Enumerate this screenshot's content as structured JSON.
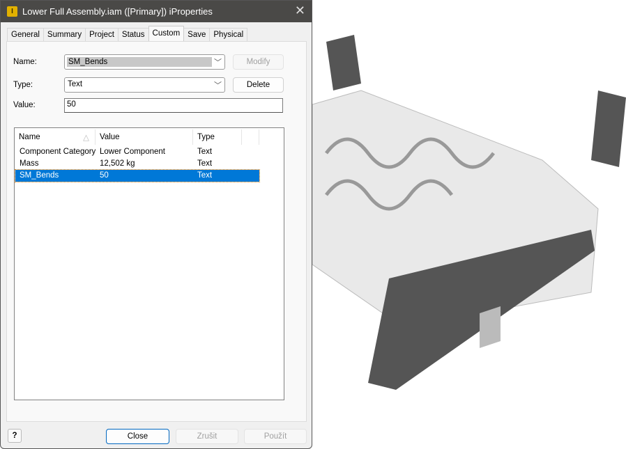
{
  "window": {
    "title": "Lower Full Assembly.iam ([Primary]) iProperties",
    "icon_letter": "I"
  },
  "tabs": [
    {
      "label": "General"
    },
    {
      "label": "Summary"
    },
    {
      "label": "Project"
    },
    {
      "label": "Status"
    },
    {
      "label": "Custom",
      "active": true
    },
    {
      "label": "Save"
    },
    {
      "label": "Physical"
    }
  ],
  "form": {
    "name_label": "Name:",
    "name_value": "SM_Bends",
    "type_label": "Type:",
    "type_value": "Text",
    "value_label": "Value:",
    "value_value": "50",
    "modify_label": "Modify",
    "delete_label": "Delete"
  },
  "table": {
    "headers": [
      "Name",
      "Value",
      "Type"
    ],
    "rows": [
      {
        "name": "Component Category",
        "value": "Lower Component",
        "type": "Text"
      },
      {
        "name": "Mass",
        "value": "12,502 kg",
        "type": "Text"
      },
      {
        "name": "SM_Bends",
        "value": "50",
        "type": "Text",
        "selected": true
      }
    ]
  },
  "footer": {
    "help": "?",
    "close": "Close",
    "cancel": "Zrušit",
    "apply": "Použít"
  },
  "colors": {
    "selection": "#0078d7",
    "titlebar": "#4a4947"
  }
}
